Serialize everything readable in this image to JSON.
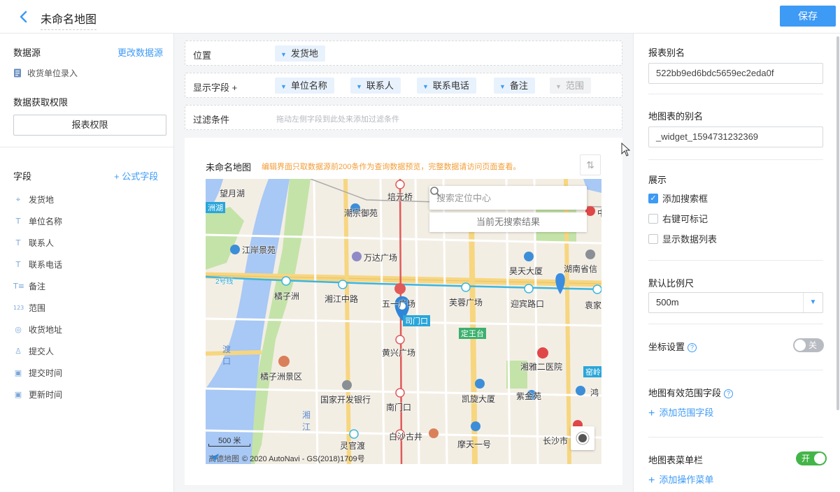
{
  "header": {
    "title": "未命名地图",
    "save_label": "保存"
  },
  "left": {
    "datasource_title": "数据源",
    "change_datasource": "更改数据源",
    "datasource_item": "收货单位录入",
    "permission_title": "数据获取权限",
    "permission_button": "报表权限",
    "fields_title": "字段",
    "formula_field": "+ 公式字段",
    "fields": [
      {
        "icon": "⌖",
        "label": "发货地"
      },
      {
        "icon": "T",
        "label": "单位名称"
      },
      {
        "icon": "T",
        "label": "联系人"
      },
      {
        "icon": "T",
        "label": "联系电话"
      },
      {
        "icon": "T≡",
        "label": "备注"
      },
      {
        "icon": "123",
        "label": "范围"
      },
      {
        "icon": "◎",
        "label": "收货地址"
      },
      {
        "icon": "♙",
        "label": "提交人"
      },
      {
        "icon": "▣",
        "label": "提交时间"
      },
      {
        "icon": "▣",
        "label": "更新时间"
      }
    ]
  },
  "center": {
    "location_label": "位置",
    "location_chip": "发货地",
    "display_label": "显示字段 +",
    "display_chips": [
      "单位名称",
      "联系人",
      "联系电话",
      "备注",
      "范围"
    ],
    "filter_label": "过滤条件",
    "filter_hint": "拖动左侧字段到此处来添加过滤条件",
    "map_title": "未命名地图",
    "notice": "编辑界面只取数据源前200条作为查询数据预览，完整数据请访问页面查看。",
    "map": {
      "search_placeholder": "搜索定位中心",
      "empty_result": "当前无搜索结果",
      "scale": "500 米",
      "attribution": "© 2020 AutoNavi - GS(2018)1709号",
      "brand": "高德地图",
      "labels": {
        "l1": "望月湖",
        "l2": "潮宗御苑",
        "l3": "培元桥",
        "l4": "万达广场",
        "l5": "江岸景苑",
        "l6": "橘子洲",
        "l7": "湘江中路",
        "l8": "五一广场",
        "l9": "芙蓉广场",
        "l10": "迎宾路口",
        "l11": "昊天大厦",
        "l12": "湖南省信",
        "l13": "袁家",
        "l14": "黄兴广场",
        "l15": "定王台",
        "l16": "湘雅二医院",
        "l17": "橘子洲景区",
        "l18": "国家开发银行",
        "l19": "凯旋大厦",
        "l20": "紫金苑",
        "l21": "南门口",
        "l22": "白沙古井",
        "l23": "灵官渡",
        "l24": "摩天一号",
        "l25": "长沙市",
        "l26": "湘江",
        "l27": "渡口",
        "l28": "2号线",
        "l29": "洲湖",
        "l30": "鸿",
        "l31": "湖南省",
        "l32": "中",
        "l33": "司门口",
        "l34": "窑岭"
      }
    }
  },
  "right": {
    "alias_title": "报表别名",
    "alias_value": "522bb9ed6bdc5659ec2eda0f",
    "map_alias_title": "地图表的别名",
    "map_alias_value": "_widget_1594731232369",
    "display_title": "展示",
    "checks": [
      {
        "label": "添加搜索框",
        "checked": "✓"
      },
      {
        "label": "右键可标记",
        "checked": ""
      },
      {
        "label": "显示数据列表",
        "checked": ""
      }
    ],
    "scale_title": "默认比例尺",
    "scale_value": "500m",
    "coord_title": "坐标设置",
    "coord_toggle": "关",
    "range_title": "地图有效范围字段",
    "add_range": "添加范围字段",
    "menu_title": "地图表菜单栏",
    "menu_toggle": "开",
    "add_menu": "添加操作菜单"
  },
  "colors": {
    "accent": "#3d9af5",
    "notice": "#f29d38",
    "toggle_on": "#44b549",
    "toggle_off": "#b8bcc2",
    "water": "#a8c8f5",
    "park": "#c4e3a8",
    "road": "#f7d680"
  }
}
